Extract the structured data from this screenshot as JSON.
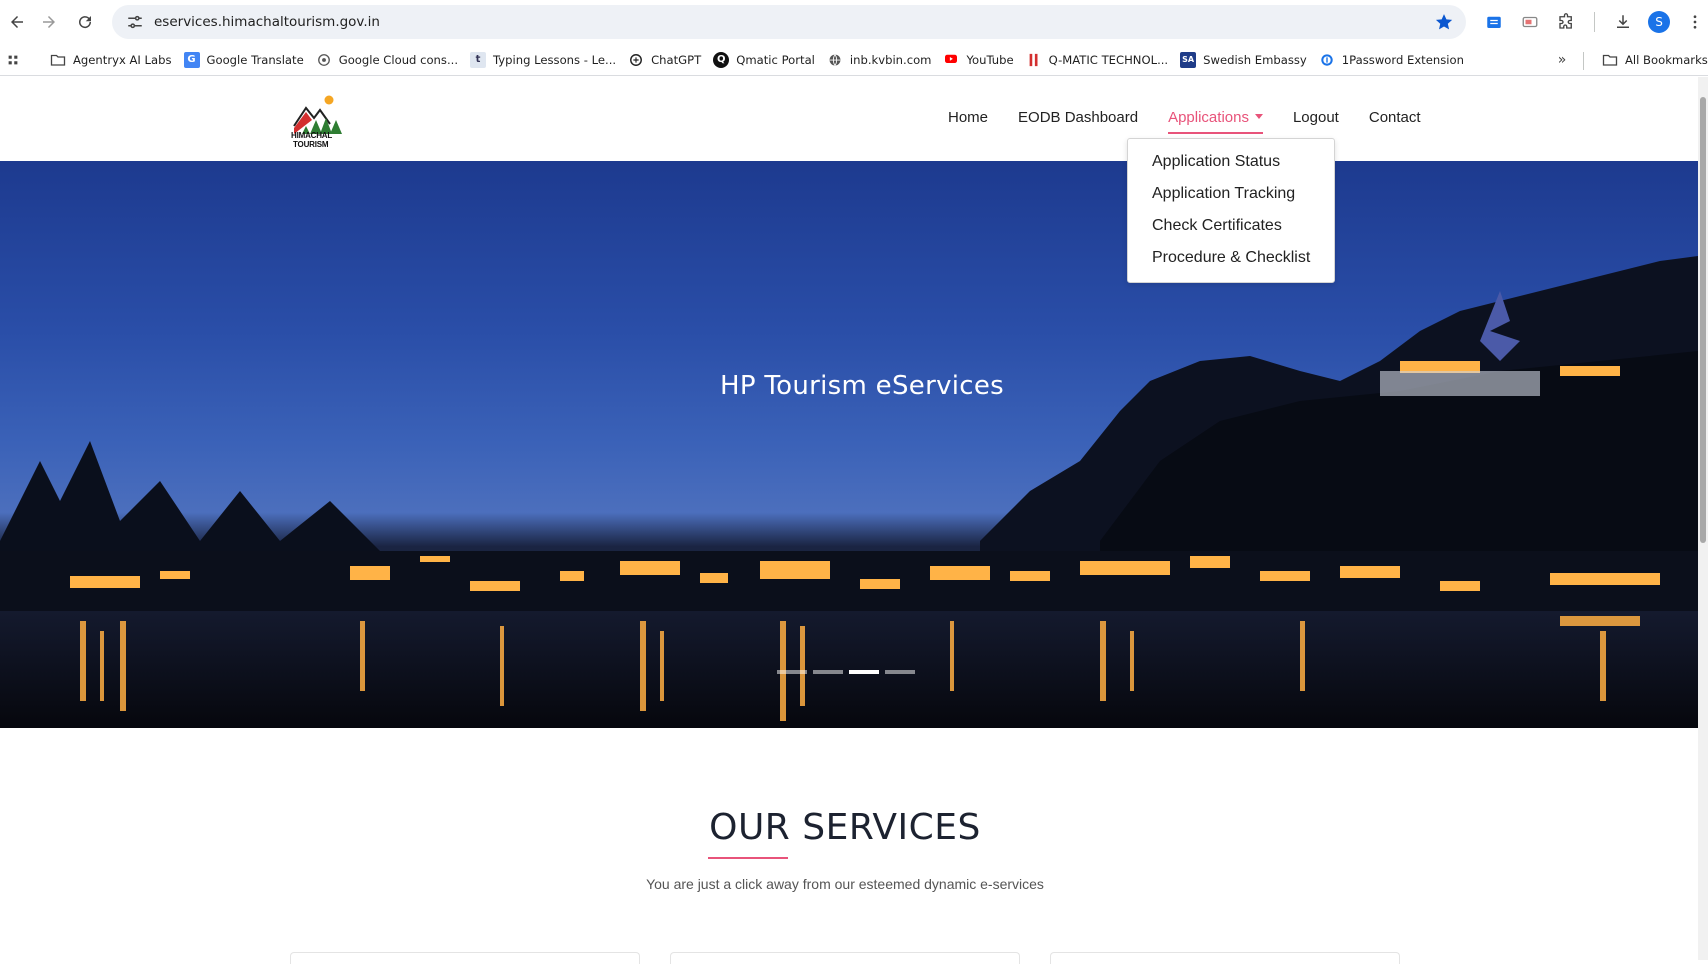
{
  "browser": {
    "url": "eservices.himachaltourism.gov.in",
    "avatar_initial": "S",
    "bookmarks": [
      {
        "label": "Agentryx AI Labs",
        "icon": "folder-icon"
      },
      {
        "label": "Google Translate",
        "icon": "google-translate-icon"
      },
      {
        "label": "Google Cloud cons...",
        "icon": "google-cloud-icon"
      },
      {
        "label": "Typing Lessons - Le...",
        "icon": "typing-icon"
      },
      {
        "label": "ChatGPT",
        "icon": "chatgpt-icon"
      },
      {
        "label": "Qmatic Portal",
        "icon": "qmatic-icon"
      },
      {
        "label": "inb.kvbin.com",
        "icon": "globe-icon"
      },
      {
        "label": "YouTube",
        "icon": "youtube-icon"
      },
      {
        "label": "Q-MATIC TECHNOL...",
        "icon": "qmatic-bars-icon"
      },
      {
        "label": "Swedish Embassy",
        "icon": "sa-icon"
      },
      {
        "label": "1Password Extension",
        "icon": "onepassword-icon"
      }
    ],
    "all_bookmarks": "All Bookmarks",
    "colors": {
      "accent": "#0b57d0",
      "avatar": "#1a73e8"
    }
  },
  "site": {
    "logo_text_line1": "HIMACHAL",
    "logo_text_line2": "TOURISM",
    "nav": {
      "home": "Home",
      "eodb": "EODB Dashboard",
      "applications": "Applications",
      "logout": "Logout",
      "contact": "Contact"
    },
    "dropdown": [
      "Application Status",
      "Application Tracking",
      "Check Certificates",
      "Procedure & Checklist"
    ],
    "hero_title": "HP Tourism eServices",
    "carousel_active_slide": 3,
    "carousel_slide_count": 4,
    "services_title": "OUR SERVICES",
    "services_subtitle": "You are just a click away from our esteemed dynamic e-services",
    "accent_color": "#e8537a"
  }
}
